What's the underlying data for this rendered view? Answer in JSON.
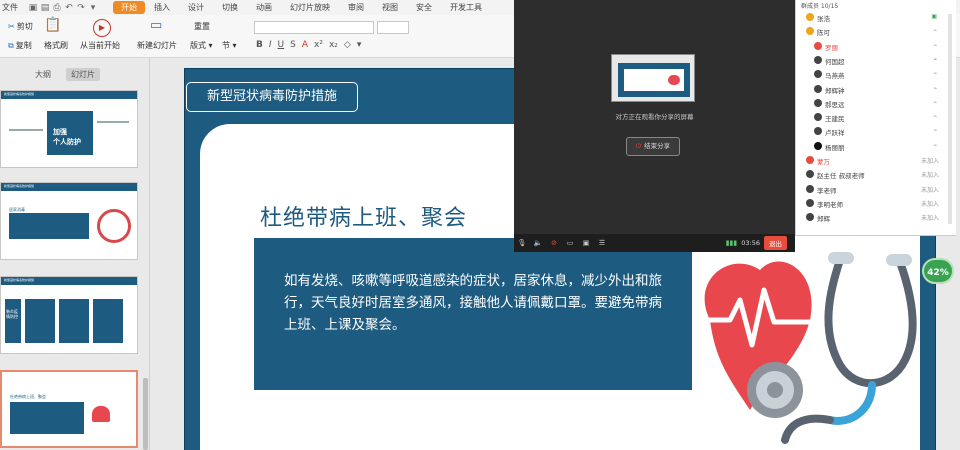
{
  "menu": {
    "items": [
      "文件",
      "开始",
      "插入",
      "设计",
      "切换",
      "动画",
      "幻灯片放映",
      "审阅",
      "视图",
      "安全",
      "开发工具"
    ],
    "active": "开始"
  },
  "ribbon": {
    "cut": "剪切",
    "copy": "复制",
    "format_painter": "格式刷",
    "paste": "粘贴",
    "play_from_current": "从当前开始",
    "new_slide": "新建幻灯片",
    "layout": "版式",
    "section": "节",
    "reset": "重置"
  },
  "left_panel": {
    "tabs": [
      "大纲",
      "幻灯片"
    ],
    "active_tab": "幻灯片",
    "thumbs": [
      {
        "title": "新型冠状病毒防护措施",
        "text": "加强个人防护"
      },
      {
        "title": "新型冠状病毒防护措施",
        "text": "居家消毒"
      },
      {
        "title": "新型冠状病毒防护措施",
        "text": "肺炎疫情发布"
      },
      {
        "title": "杜绝带病上班、聚会",
        "text": ""
      }
    ],
    "thumb1_box": "加强\n个人防护",
    "thumb3_box": "肺炎疫情防控"
  },
  "slide": {
    "tag": "新型冠状病毒防护措施",
    "heading": "杜绝带病上班、聚会",
    "body": "如有发烧、咳嗽等呼吸道感染的症状，居家休息，减少外出和旅行，天气良好时居室多通风，接触他人请佩戴口罩。要避免带病上班、上课及聚会。"
  },
  "zoom": "42%",
  "share": {
    "message": "对方正在观看你分享的屏幕",
    "stop_label": "结束分享",
    "time": "03:56",
    "exit_label": "退出"
  },
  "members": {
    "header": "群成员 10/15",
    "list": [
      {
        "name": "张浩",
        "status": "",
        "color": "#f0a31d"
      },
      {
        "name": "陈可",
        "status": "",
        "color": "#f0a31d"
      },
      {
        "name": "罗丽",
        "status": "",
        "color": "#e74c3c"
      },
      {
        "name": "何国超",
        "status": "",
        "color": "#444444"
      },
      {
        "name": "马燕燕",
        "status": "",
        "color": "#444444"
      },
      {
        "name": "郑辉钟",
        "status": "",
        "color": "#444444"
      },
      {
        "name": "郝思远",
        "status": "",
        "color": "#444444"
      },
      {
        "name": "王建民",
        "status": "",
        "color": "#444444"
      },
      {
        "name": "卢跃祥",
        "status": "",
        "color": "#444444"
      },
      {
        "name": "杨丽丽",
        "status": "",
        "color": "#111111"
      },
      {
        "name": "蒙万",
        "status": "未加入",
        "color": "#e74c3c"
      },
      {
        "name": "赵主任 叔叔老师",
        "status": "未加入",
        "color": "#444444"
      },
      {
        "name": "李老师",
        "status": "未加入",
        "color": "#444444"
      },
      {
        "name": "李明老师",
        "status": "未加入",
        "color": "#444444"
      },
      {
        "name": "郑辉",
        "status": "未加入",
        "color": "#444444"
      }
    ]
  },
  "colors": {
    "accent": "#f08a24",
    "slide_blue": "#1d5b80",
    "heart_red": "#e8484d",
    "zoom_green": "#3aa351"
  }
}
